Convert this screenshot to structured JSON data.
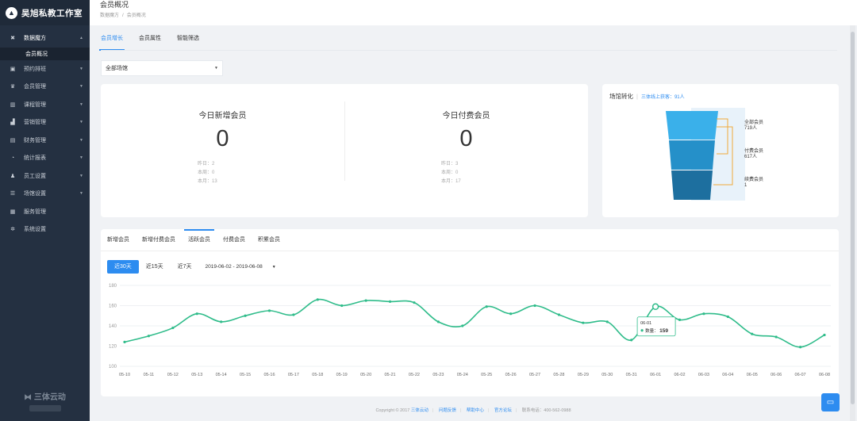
{
  "app": {
    "brand": "吴旭私教工作室",
    "page_title": "会员概况",
    "breadcrumb": [
      "数据魔方",
      "会员概况"
    ]
  },
  "sidebar": {
    "items": [
      {
        "label": "数据魔方",
        "icon": "cube-icon",
        "open": true
      },
      {
        "label": "预约排班",
        "icon": "calendar-icon"
      },
      {
        "label": "会员管理",
        "icon": "crown-icon"
      },
      {
        "label": "课程管理",
        "icon": "book-icon"
      },
      {
        "label": "营销管理",
        "icon": "chart-icon"
      },
      {
        "label": "财务管理",
        "icon": "wallet-icon"
      },
      {
        "label": "统计报表",
        "icon": "pie-icon"
      },
      {
        "label": "员工设置",
        "icon": "person-icon"
      },
      {
        "label": "场馆设置",
        "icon": "sliders-icon"
      },
      {
        "label": "服务管理",
        "icon": "grid-icon"
      },
      {
        "label": "系统设置",
        "icon": "gear-icon"
      }
    ],
    "sub_item": "会员概况",
    "footer_logo": "三体云动"
  },
  "tabs_top": [
    {
      "label": "会员增长",
      "active": true
    },
    {
      "label": "会员属性"
    },
    {
      "label": "智能筛选"
    }
  ],
  "venue_select": "全部场馆",
  "stats": [
    {
      "title": "今日新增会员",
      "value": "0",
      "rows": [
        "昨日：2",
        "本周：0",
        "本月：13"
      ]
    },
    {
      "title": "今日付费会员",
      "value": "0",
      "rows": [
        "昨日：3",
        "本周：0",
        "本月：17"
      ]
    }
  ],
  "funnel": {
    "title": "场馆转化",
    "subtitle": "三体线上获客：91人",
    "levels": [
      {
        "name": "全部会员",
        "count": "719人"
      },
      {
        "name": "付费会员",
        "count": "617人"
      },
      {
        "name": "续费会员",
        "count": "1"
      }
    ],
    "colors": [
      "#3ab0ea",
      "#2590c9",
      "#1d6f9f"
    ]
  },
  "chart_tabs": [
    {
      "label": "新增会员"
    },
    {
      "label": "新增付费会员"
    },
    {
      "label": "活跃会员",
      "active": true
    },
    {
      "label": "付费会员"
    },
    {
      "label": "积累会员"
    }
  ],
  "range_buttons": [
    {
      "label": "近30天",
      "active": true
    },
    {
      "label": "近15天"
    },
    {
      "label": "近7天"
    }
  ],
  "date_range": "2019-06-02 - 2019-06-08",
  "tooltip": {
    "date": "06-01",
    "label": "数量",
    "value": "159"
  },
  "footer": {
    "copyright": "Copyright © 2017",
    "links": [
      "三体云动",
      "问题反馈",
      "帮助中心",
      "官方论坛"
    ],
    "phone": "联系电话：400-562-0988"
  },
  "chart_data": {
    "type": "line",
    "categories": [
      "05-10",
      "05-11",
      "05-12",
      "05-13",
      "05-14",
      "05-15",
      "05-16",
      "05-17",
      "05-18",
      "05-19",
      "05-20",
      "05-21",
      "05-22",
      "05-23",
      "05-24",
      "05-25",
      "05-26",
      "05-27",
      "05-28",
      "05-29",
      "05-30",
      "05-31",
      "06-01",
      "06-02",
      "06-03",
      "06-04",
      "06-05",
      "06-06",
      "06-07",
      "06-08"
    ],
    "values": [
      124,
      130,
      138,
      152,
      144,
      150,
      155,
      151,
      166,
      160,
      165,
      164,
      163,
      144,
      140,
      159,
      152,
      160,
      151,
      143,
      144,
      126,
      159,
      146,
      152,
      149,
      132,
      129,
      119,
      131
    ],
    "ylim": [
      100,
      180
    ],
    "yticks": [
      100,
      120,
      140,
      160,
      180
    ],
    "color": "#2fbc8a",
    "grid": true
  }
}
